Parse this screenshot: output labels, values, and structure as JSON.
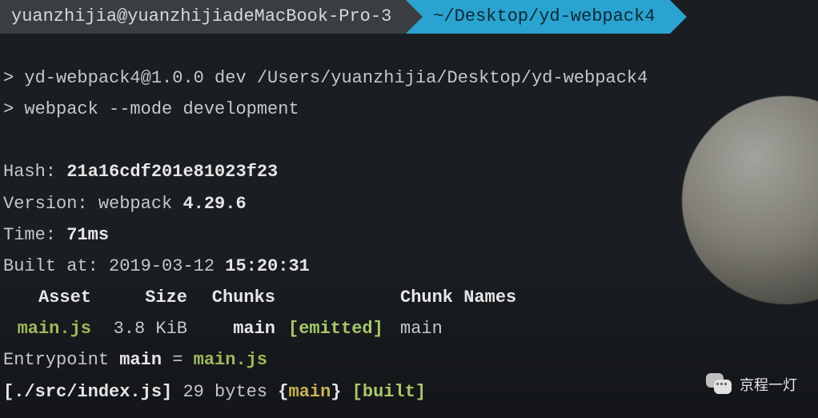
{
  "header": {
    "user_host": "yuanzhijia@yuanzhijiadeMacBook-Pro-3",
    "cwd": "~/Desktop/yd-webpack4"
  },
  "cmd": {
    "line1_prompt": "> ",
    "line1_pkg": "yd-webpack4@1.0.0 dev /Users/yuanzhijia/Desktop/yd-webpack4",
    "line2_prompt": "> ",
    "line2_cmd": "webpack --mode development"
  },
  "stats": {
    "hash_label": "Hash: ",
    "hash_value": "21a16cdf201e81023f23",
    "version_label": "Version: ",
    "version_tool": "webpack ",
    "version_value": "4.29.6",
    "time_label": "Time: ",
    "time_value": "71ms",
    "built_label": "Built at: ",
    "built_date": "2019-03-12 ",
    "built_time": "15:20:31"
  },
  "table": {
    "headers": {
      "asset": "Asset",
      "size": "Size",
      "chunks": "Chunks",
      "status": "",
      "names": "Chunk Names"
    },
    "row": {
      "asset": "main.js",
      "size": "3.8 KiB",
      "chunks": "main",
      "status": "[emitted]",
      "names": "main"
    }
  },
  "entry": {
    "prefix": "Entrypoint ",
    "name": "main",
    "eq": " = ",
    "file": "main.js"
  },
  "module": {
    "open": "[",
    "path": "./src/index.js",
    "close": "]",
    "size": " 29 bytes ",
    "lb": "{",
    "chunk": "main",
    "rb": "}",
    "sp": " ",
    "status": "[built]"
  },
  "watermark": "京程一灯"
}
